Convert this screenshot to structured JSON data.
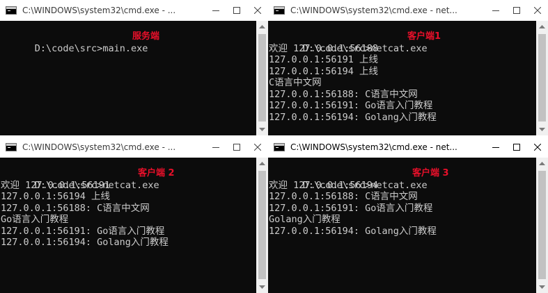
{
  "windows": [
    {
      "title": "C:\\WINDOWS\\system32\\cmd.exe - ...",
      "active": false,
      "annotation": "服务端",
      "prompt": "D:\\code\\src>main.exe",
      "lines": []
    },
    {
      "title": "C:\\WINDOWS\\system32\\cmd.exe - net...",
      "active": false,
      "annotation": "客户端1",
      "prompt": "D:\\code\\src>netcat.exe",
      "lines": [
        "欢迎 127.0.0.1:56188",
        "127.0.0.1:56191 上线",
        "127.0.0.1:56194 上线",
        "C语言中文网",
        "127.0.0.1:56188: C语言中文网",
        "127.0.0.1:56191: Go语言入门教程",
        "127.0.0.1:56194: Golang入门教程"
      ]
    },
    {
      "title": "C:\\WINDOWS\\system32\\cmd.exe - ...",
      "active": false,
      "annotation": "客户端 2",
      "prompt": "D:\\code\\src>netcat.exe",
      "lines": [
        "欢迎 127.0.0.1:56191",
        "127.0.0.1:56194 上线",
        "127.0.0.1:56188: C语言中文网",
        "Go语言入门教程",
        "127.0.0.1:56191: Go语言入门教程",
        "127.0.0.1:56194: Golang入门教程"
      ]
    },
    {
      "title": "C:\\WINDOWS\\system32\\cmd.exe - net...",
      "active": true,
      "annotation": "客户端 3",
      "prompt": "D:\\code\\src>netcat.exe",
      "lines": [
        "欢迎 127.0.0.1:56194",
        "127.0.0.1:56188: C语言中文网",
        "127.0.0.1:56191: Go语言入门教程",
        "Golang入门教程",
        "127.0.0.1:56194: Golang入门教程"
      ]
    }
  ],
  "icons": {
    "app": "cmd-console-icon",
    "minimize": "minimize-icon",
    "maximize": "maximize-icon",
    "close": "close-icon",
    "scroll_up": "scroll-up-arrow-icon",
    "scroll_down": "scroll-down-arrow-icon"
  },
  "colors": {
    "console_bg": "#0c0c0c",
    "console_text": "#cccccc",
    "annotation": "#e8102a",
    "titlebar_bg": "#ffffff"
  }
}
